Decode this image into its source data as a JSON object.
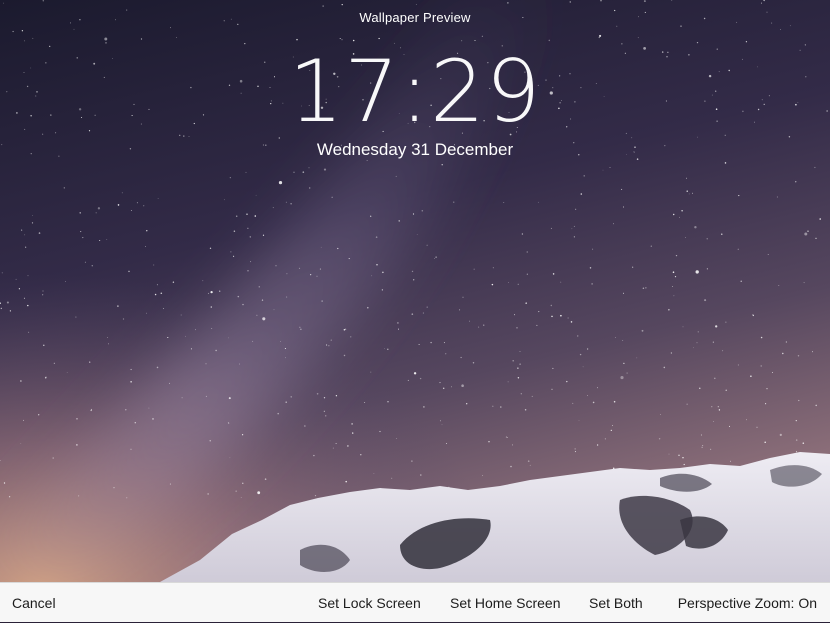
{
  "header": {
    "title": "Wallpaper Preview"
  },
  "lock_screen": {
    "time": "17:29",
    "date": "Wednesday 31 December"
  },
  "wallpaper": {
    "subject": "starry night sky with Milky Way above snowy mountain",
    "sky_colors": [
      "#1c1a30",
      "#3a3050",
      "#5a4a6a",
      "#9a7a8a",
      "#c9a08a"
    ],
    "snow_color": "#e6e4ec",
    "rock_color": "#3b3844"
  },
  "toolbar": {
    "cancel_label": "Cancel",
    "set_lock_label": "Set Lock Screen",
    "set_home_label": "Set Home Screen",
    "set_both_label": "Set Both",
    "perspective_zoom_label": "Perspective Zoom: On"
  }
}
